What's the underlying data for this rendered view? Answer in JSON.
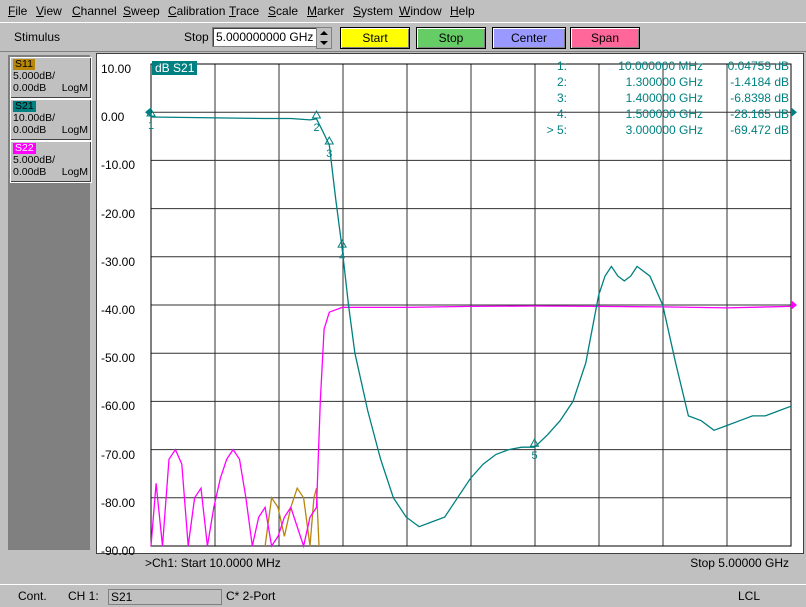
{
  "menu": [
    "File",
    "View",
    "Channel",
    "Sweep",
    "Calibration",
    "Trace",
    "Scale",
    "Marker",
    "System",
    "Window",
    "Help"
  ],
  "toolbar": {
    "stimulus_label": "Stimulus",
    "stop_label": "Stop",
    "stop_value": "5.000000000 GHz",
    "start_button": "Start",
    "stop_button": "Stop",
    "center_button": "Center",
    "span_button": "Span",
    "colors": {
      "start": "#ffff00",
      "stop": "#66cc66",
      "center": "#9999ff",
      "span": "#ff6699"
    }
  },
  "traces": [
    {
      "name": "S11",
      "scale": "5.000dB/",
      "ref": "0.00dB",
      "format": "LogM",
      "color": "#b8860b"
    },
    {
      "name": "S21",
      "scale": "10.00dB/",
      "ref": "0.00dB",
      "format": "LogM",
      "color": "#008080"
    },
    {
      "name": "S22",
      "scale": "5.000dB/",
      "ref": "0.00dB",
      "format": "LogM",
      "color": "#ff00ff"
    }
  ],
  "chart": {
    "trace_title": "dB S21",
    "y_ticks": [
      "10.00",
      "0.00",
      "-10.00",
      "-20.00",
      "-30.00",
      "-40.00",
      "-50.00",
      "-60.00",
      "-70.00",
      "-80.00",
      "-90.00"
    ],
    "footer_left": ">Ch1: Start  10.0000 MHz",
    "footer_right": "Stop  5.00000 GHz",
    "markers": [
      {
        "num": "1:",
        "freq": "10.000000 MHz",
        "val": "0.04759 dB"
      },
      {
        "num": "2:",
        "freq": "1.300000 GHz",
        "val": "-1.4184 dB"
      },
      {
        "num": "3:",
        "freq": "1.400000 GHz",
        "val": "-6.8398 dB"
      },
      {
        "num": "4:",
        "freq": "1.500000 GHz",
        "val": "-28.165 dB"
      },
      {
        "num": "> 5:",
        "freq": "3.000000 GHz",
        "val": "-69.472 dB"
      }
    ]
  },
  "chart_data": {
    "type": "line",
    "xlim": [
      0.01,
      5.0
    ],
    "ylim": [
      -90,
      10
    ],
    "grid": true,
    "series": [
      {
        "name": "S21",
        "color": "#008080",
        "x": [
          0.01,
          0.3,
          0.6,
          0.9,
          1.1,
          1.25,
          1.3,
          1.35,
          1.4,
          1.45,
          1.5,
          1.55,
          1.6,
          1.7,
          1.8,
          1.9,
          2.0,
          2.1,
          2.2,
          2.3,
          2.4,
          2.5,
          2.6,
          2.7,
          2.8,
          2.9,
          3.0,
          3.1,
          3.2,
          3.3,
          3.4,
          3.5,
          3.55,
          3.6,
          3.65,
          3.7,
          3.75,
          3.8,
          3.9,
          4.0,
          4.1,
          4.2,
          4.3,
          4.4,
          4.5,
          4.6,
          4.7,
          4.8,
          4.9,
          5.0
        ],
        "y": [
          -1.0,
          -1.1,
          -1.2,
          -1.3,
          -1.3,
          -1.6,
          -1.4,
          -4,
          -6.8,
          -18,
          -28.2,
          -40,
          -50,
          -62,
          -72,
          -80,
          -84,
          -86,
          -85,
          -84,
          -80,
          -76,
          -73,
          -71,
          -70,
          -69.5,
          -69.5,
          -67,
          -64,
          -60,
          -52,
          -38,
          -34,
          -32,
          -34,
          -35,
          -34,
          -32,
          -34,
          -40,
          -52,
          -63,
          -64,
          -66,
          -65,
          -64,
          -63,
          -63,
          -62,
          -61
        ]
      },
      {
        "name": "S22",
        "color": "#ff00ff",
        "x": [
          0.01,
          0.05,
          0.1,
          0.15,
          0.2,
          0.25,
          0.3,
          0.35,
          0.4,
          0.45,
          0.5,
          0.55,
          0.6,
          0.65,
          0.7,
          0.75,
          0.8,
          0.85,
          0.9,
          0.95,
          1.0,
          1.05,
          1.1,
          1.15,
          1.2,
          1.25,
          1.3,
          1.33,
          1.36,
          1.4,
          1.5,
          2.0,
          2.5,
          3.0,
          3.5,
          4.0,
          4.5,
          5.0
        ],
        "y": [
          -90,
          -77,
          -90,
          -72,
          -70,
          -73,
          -90,
          -80,
          -78,
          -90,
          -82,
          -76,
          -72,
          -70,
          -72,
          -80,
          -90,
          -84,
          -82,
          -90,
          -88,
          -84,
          -82,
          -86,
          -90,
          -84,
          -82,
          -60,
          -45,
          -41.5,
          -40.5,
          -40.5,
          -40.3,
          -40.2,
          -40.3,
          -40.4,
          -40.6,
          -40.3
        ]
      },
      {
        "name": "S11",
        "color": "#b8860b",
        "x": [
          0.9,
          0.95,
          1.0,
          1.05,
          1.1,
          1.15,
          1.2,
          1.25,
          1.28,
          1.3,
          1.32
        ],
        "y": [
          -90,
          -80,
          -82,
          -88,
          -82,
          -78,
          -80,
          -90,
          -80,
          -78,
          -90
        ]
      }
    ]
  },
  "status": {
    "mode": "Cont.",
    "channel": "CH 1:",
    "trace": "S21",
    "cal": "C* 2-Port",
    "ref": "LCL"
  }
}
